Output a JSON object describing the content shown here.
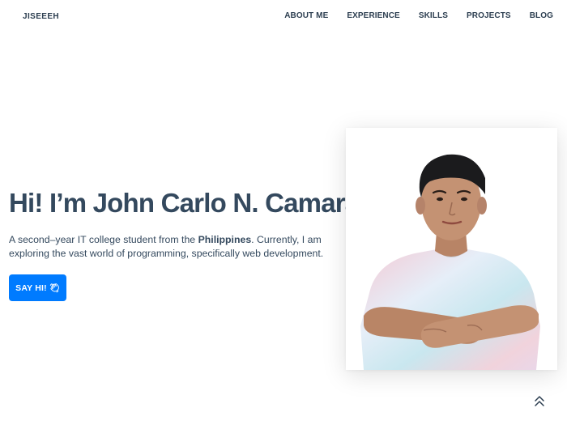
{
  "header": {
    "brand": "JISEEEH",
    "nav": [
      "ABOUT ME",
      "EXPERIENCE",
      "SKILLS",
      "PROJECTS",
      "BLOG"
    ]
  },
  "hero": {
    "title": "Hi! I’m John Carlo N. Camara,",
    "description_before": "A second–year IT college student from the ",
    "description_bold": "Philippines",
    "description_after": ". Currently, I am exploring the vast world of programming, specifically web development.",
    "cta_label": "SAY HI!",
    "cta_icon": "waving-hand-icon"
  },
  "photo": {
    "subject": "profile-photo"
  },
  "scroll_top": {
    "icon": "double-chevron-up-icon"
  },
  "colors": {
    "primary_button": "#007bff",
    "heading_text": "#34495e",
    "nav_text": "#2c3e50"
  }
}
